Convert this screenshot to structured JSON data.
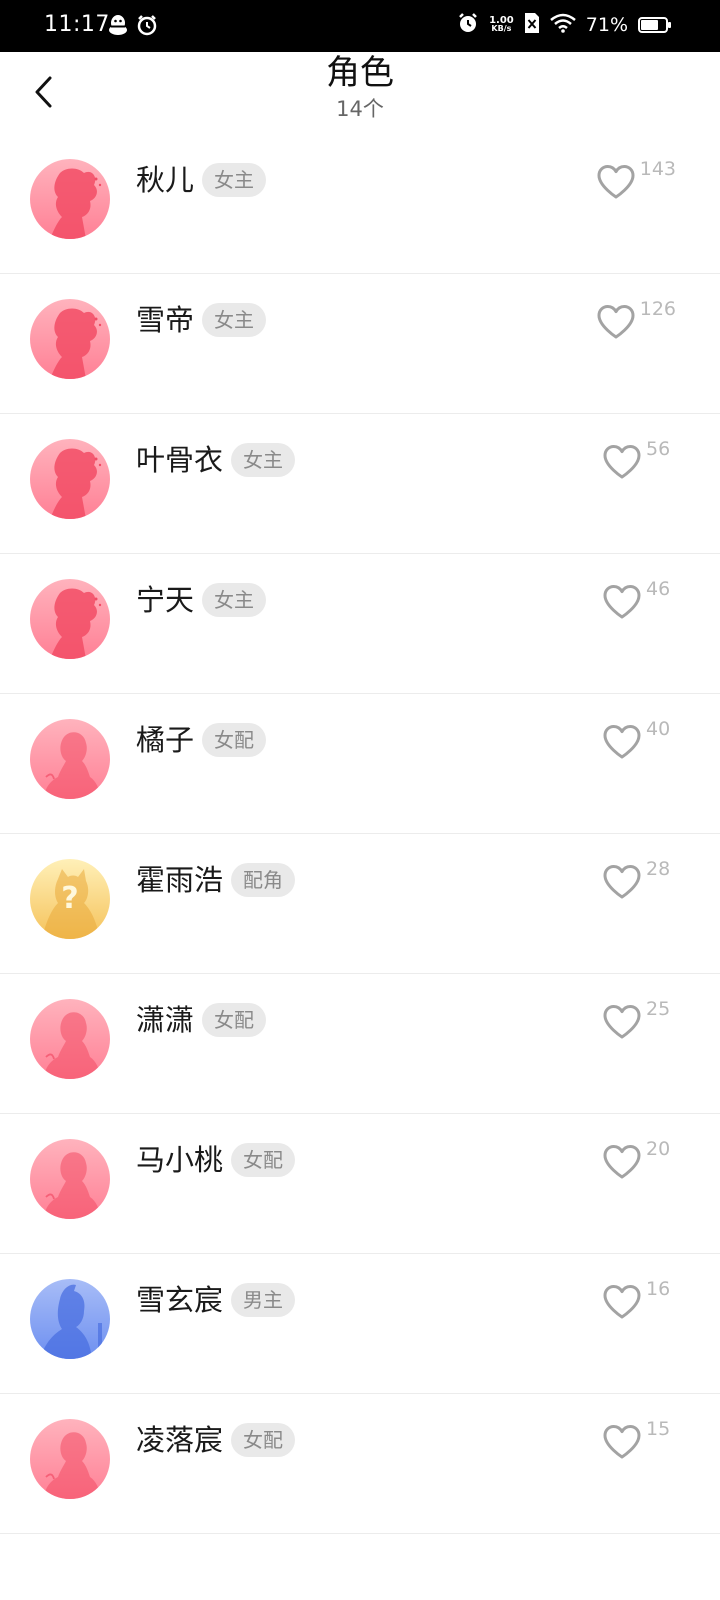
{
  "status_bar": {
    "time": "11:17",
    "net_speed_value": "1.00",
    "net_speed_unit": "KB/s",
    "battery_percent": "71%",
    "battery_level": 0.71,
    "left_icons": [
      "qq-penguin-icon",
      "alarm-icon"
    ],
    "right_icons": [
      "alarm-icon",
      "net-speed",
      "sim-x-icon",
      "wifi-icon",
      "battery-icon"
    ]
  },
  "header": {
    "title": "角色",
    "subtitle": "14个"
  },
  "characters": [
    {
      "name": "秋儿",
      "role": "女主",
      "likes": "143",
      "avatar": "female-lead"
    },
    {
      "name": "雪帝",
      "role": "女主",
      "likes": "126",
      "avatar": "female-lead"
    },
    {
      "name": "叶骨衣",
      "role": "女主",
      "likes": "56",
      "avatar": "female-lead"
    },
    {
      "name": "宁天",
      "role": "女主",
      "likes": "46",
      "avatar": "female-lead"
    },
    {
      "name": "橘子",
      "role": "女配",
      "likes": "40",
      "avatar": "female-support"
    },
    {
      "name": "霍雨浩",
      "role": "配角",
      "likes": "28",
      "avatar": "unknown"
    },
    {
      "name": "潇潇",
      "role": "女配",
      "likes": "25",
      "avatar": "female-support"
    },
    {
      "name": "马小桃",
      "role": "女配",
      "likes": "20",
      "avatar": "female-support"
    },
    {
      "name": "雪玄宸",
      "role": "男主",
      "likes": "16",
      "avatar": "male-lead"
    },
    {
      "name": "凌落宸",
      "role": "女配",
      "likes": "15",
      "avatar": "female-support"
    }
  ],
  "colors": {
    "female_avatar_top": "#ffb3bd",
    "female_avatar_bottom": "#ff8095",
    "female_silhouette": "#f24c65",
    "unknown_avatar_top": "#fff0b8",
    "unknown_avatar_bottom": "#f5c25a",
    "male_avatar_top": "#a8bdf7",
    "male_avatar_bottom": "#6d8ff0",
    "tag_bg": "#e9e9e9",
    "tag_text": "#8a8a8a",
    "like_count": "#b9b9b9"
  }
}
